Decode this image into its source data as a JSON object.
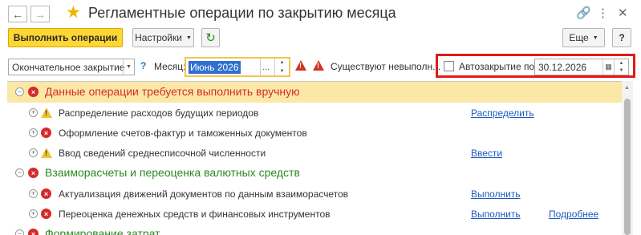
{
  "window": {
    "title": "Регламентные операции по закрытию месяца"
  },
  "toolbar": {
    "execute_label": "Выполнить операции",
    "settings_label": "Настройки",
    "more_label": "Еще",
    "help_label": "?"
  },
  "filters": {
    "mode_value": "Окончательное закрытие",
    "help_q": "?",
    "month_label": "Месяц:",
    "month_value": "Июнь 2026",
    "status_text": "Существуют невыполн...",
    "autoclose_label": "Автозакрытие по:",
    "autoclose_checked": false,
    "date_value": "30.12.2026"
  },
  "groups": [
    {
      "title": "Данные операции требуется выполнить вручную",
      "color": "#d62a2a",
      "icon": "error-icon",
      "expanded": true,
      "items": [
        {
          "status_icon": "warning-icon",
          "label": "Распределение расходов будущих периодов",
          "action": "Распределить",
          "details": ""
        },
        {
          "status_icon": "error-icon",
          "label": "Оформление счетов-фактур и таможенных документов",
          "action": "",
          "details": ""
        },
        {
          "status_icon": "warning-icon",
          "label": "Ввод сведений среднесписочной численности",
          "action": "Ввести",
          "details": ""
        }
      ]
    },
    {
      "title": "Взаиморасчеты и переоценка валютных средств",
      "color": "#2a8a1f",
      "icon": "error-icon",
      "expanded": true,
      "items": [
        {
          "status_icon": "error-icon",
          "label": "Актуализация движений документов по данным взаиморасчетов",
          "action": "Выполнить",
          "details": ""
        },
        {
          "status_icon": "error-icon",
          "label": "Переоценка денежных средств и финансовых инструментов",
          "action": "Выполнить",
          "details": "Подробнее"
        }
      ]
    },
    {
      "title": "Формирование затрат",
      "color": "#2a8a1f",
      "icon": "error-icon",
      "expanded": true,
      "items": []
    }
  ],
  "colors": {
    "accent_yellow": "#ffd633",
    "highlight_row": "#fbe8a6",
    "link": "#1b5bbd",
    "error": "#d62a2a",
    "warning": "#f2c230",
    "focus_box": "#e01b1b"
  }
}
